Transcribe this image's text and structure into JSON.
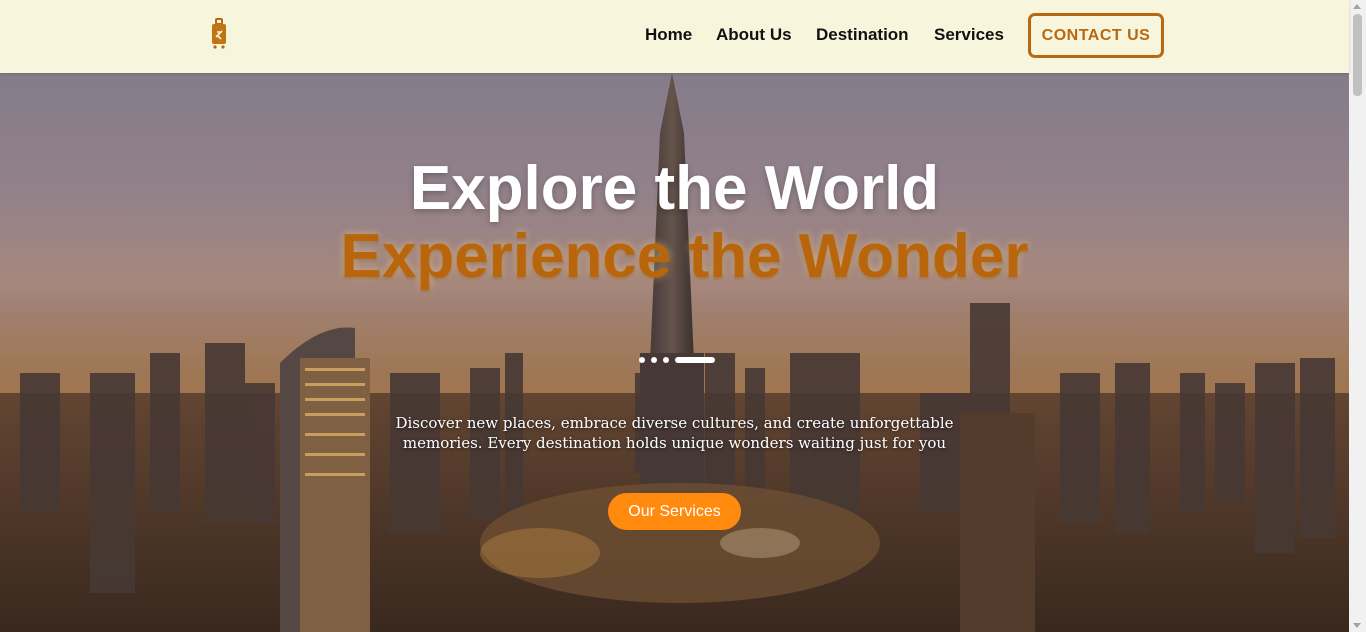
{
  "nav": {
    "logo_icon": "suitcase-icon",
    "links": [
      {
        "label": "Home"
      },
      {
        "label": "About Us"
      },
      {
        "label": "Destination"
      },
      {
        "label": "Services"
      }
    ],
    "contact_label": "CONTACT US"
  },
  "hero": {
    "headline_line1": "Explore the World",
    "headline_line2": "Experience the Wonder",
    "slides_total": 4,
    "active_slide": 4,
    "tagline_line1": "Discover new places, embrace diverse cultures, and create unforgettable",
    "tagline_line2": "memories. Every destination holds unique wonders waiting just for you",
    "cta_label": "Our Services"
  },
  "colors": {
    "navbar_bg": "#f7f5dc",
    "accent": "#b8690f",
    "cta_bg": "#ff8a0d"
  }
}
